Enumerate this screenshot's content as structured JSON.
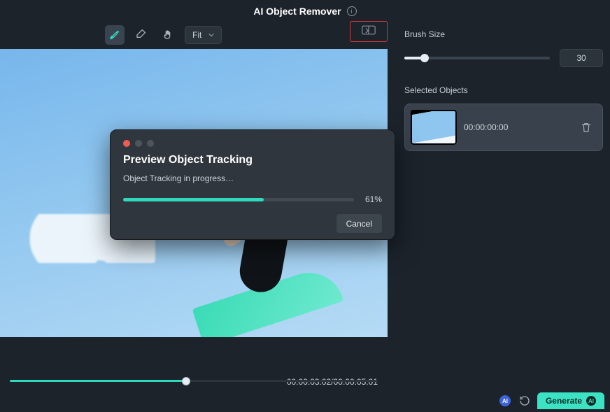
{
  "header": {
    "title": "AI Object Remover"
  },
  "toolbar": {
    "fit_label": "Fit",
    "icons": [
      "brush-icon",
      "eraser-icon",
      "hand-icon"
    ],
    "compare_icon": "compare-icon"
  },
  "playback": {
    "current": "00:00:03:02",
    "total": "00:00:05:01",
    "progress_pct": 48
  },
  "brush": {
    "label": "Brush Size",
    "value": "30"
  },
  "selected": {
    "label": "Selected Objects",
    "items": [
      {
        "time": "00:00:00:00"
      }
    ]
  },
  "footer": {
    "generate_label": "Generate"
  },
  "dialog": {
    "title": "Preview Object Tracking",
    "message": "Object Tracking in progress…",
    "percent_label": "61%",
    "percent_value": 61,
    "cancel_label": "Cancel"
  }
}
